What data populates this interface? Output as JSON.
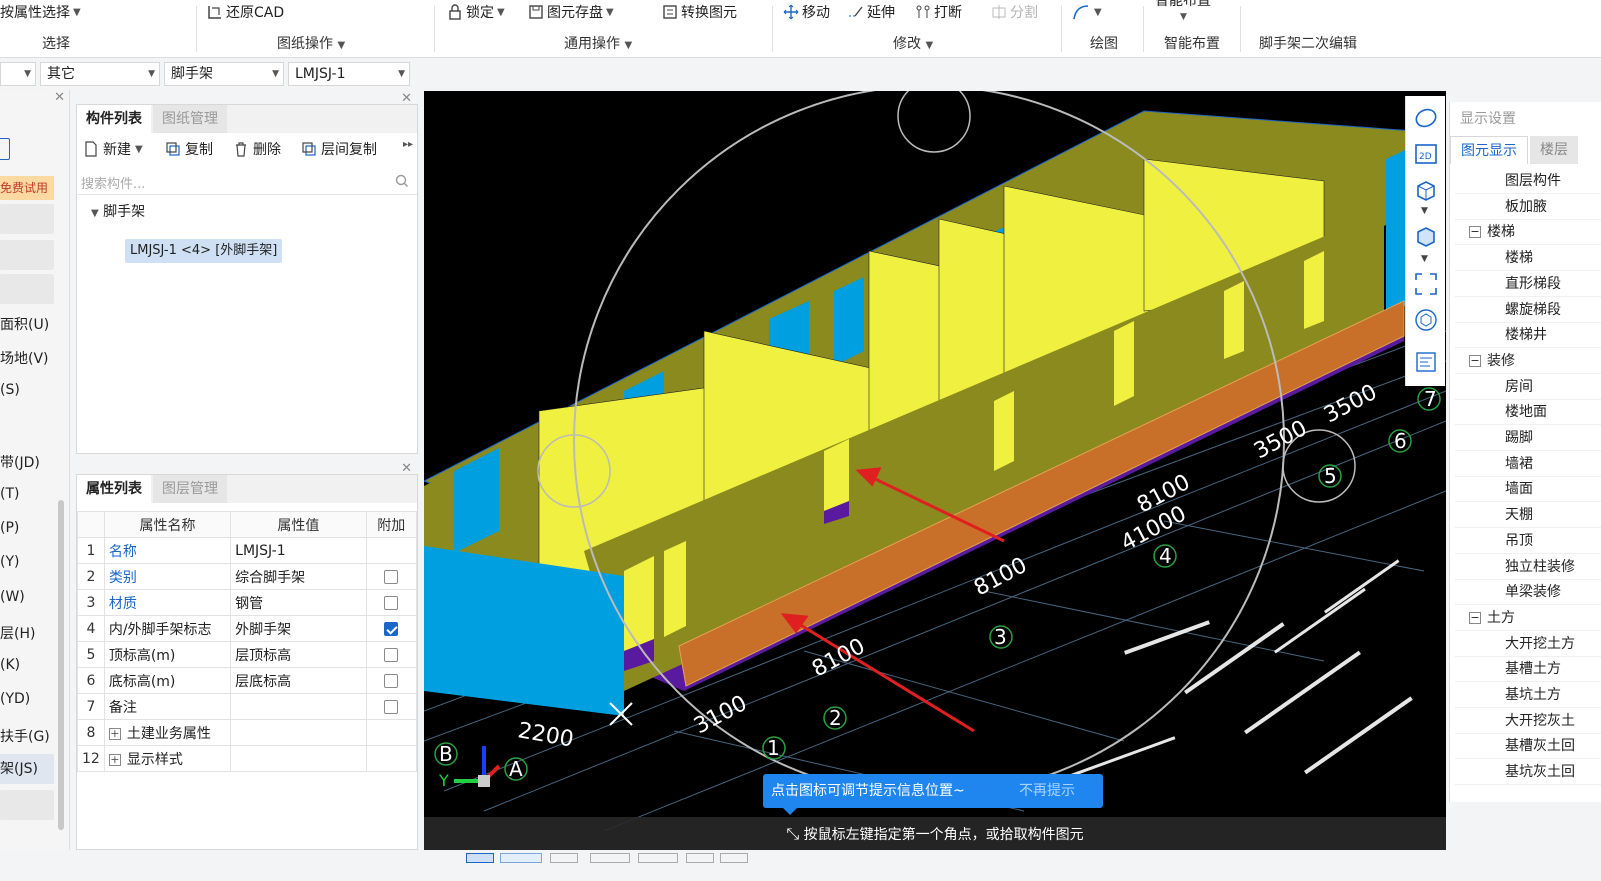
{
  "ribbon": {
    "select_prop": "按属性选择",
    "select_label": "选择",
    "restore_cad": "还原CAD",
    "drawing_ops_label": "图纸操作",
    "lock": "锁定",
    "element_save": "图元存盘",
    "convert_element": "转换图元",
    "common_ops_label": "通用操作",
    "move": "移动",
    "extend": "延伸",
    "break": "打断",
    "split": "分割",
    "modify_label": "修改",
    "draw_label": "绘图",
    "smart_layout": "智能布置",
    "smart_layout_label": "智能布置",
    "scaffold_edit_label": "脚手架二次编辑"
  },
  "combos": {
    "c1": "其它",
    "c2": "脚手架",
    "c3": "LMJSJ-1"
  },
  "left_strip": {
    "free_trial": "免费试用",
    "items": [
      "面积(U)",
      "场地(V)",
      "(S)",
      "带(JD)",
      "(T)",
      "(P)",
      "(Y)",
      "(W)",
      "层(H)",
      "(K)",
      "(YD)",
      "扶手(G)",
      "架(JS)"
    ]
  },
  "component_panel": {
    "tab_component_list": "构件列表",
    "tab_drawing_mgmt": "图纸管理",
    "new": "新建",
    "copy": "复制",
    "delete": "删除",
    "floor_copy": "层间复制",
    "search_placeholder": "搜索构件...",
    "tree_root": "脚手架",
    "tree_item": "LMJSJ-1 <4> [外脚手架]"
  },
  "property_panel": {
    "tab_props": "属性列表",
    "tab_layers": "图层管理",
    "col_name": "属性名称",
    "col_value": "属性值",
    "col_extra": "附加",
    "rows": [
      {
        "num": "1",
        "name": "名称",
        "value": "LMJSJ-1",
        "blue": true,
        "check": "none"
      },
      {
        "num": "2",
        "name": "类别",
        "value": "综合脚手架",
        "blue": true,
        "check": "off"
      },
      {
        "num": "3",
        "name": "材质",
        "value": "钢管",
        "blue": true,
        "check": "off"
      },
      {
        "num": "4",
        "name": "内/外脚手架标志",
        "value": "外脚手架",
        "blue": false,
        "check": "on"
      },
      {
        "num": "5",
        "name": "顶标高(m)",
        "value": "层顶标高",
        "blue": false,
        "check": "off"
      },
      {
        "num": "6",
        "name": "底标高(m)",
        "value": "层底标高",
        "blue": false,
        "check": "off"
      },
      {
        "num": "7",
        "name": "备注",
        "value": "",
        "blue": false,
        "check": "off"
      },
      {
        "num": "8",
        "name": "土建业务属性",
        "value": "",
        "blue": false,
        "check": "none",
        "expand": true
      },
      {
        "num": "12",
        "name": "显示样式",
        "value": "",
        "blue": false,
        "check": "none",
        "expand": true
      }
    ]
  },
  "viewport": {
    "dims": [
      "3500",
      "3500",
      "8100",
      "41000",
      "8100",
      "8100",
      "3100",
      "2200"
    ],
    "axis_nums": [
      "7",
      "6",
      "5",
      "4",
      "3",
      "2",
      "1"
    ],
    "axis_letters": [
      "B",
      "A"
    ],
    "axis_y": "Y",
    "status_text": "按鼠标左键指定第一个角点，或拾取构件图元"
  },
  "tip": {
    "text": "点击图标可调节提示信息位置~",
    "dismiss": "不再提示"
  },
  "display_panel": {
    "title": "显示设置",
    "tab_element": "图元显示",
    "tab_floor": "楼层",
    "rows": [
      {
        "label": "图层构件",
        "group": false
      },
      {
        "label": "板加腋",
        "group": false
      },
      {
        "label": "楼梯",
        "group": true
      },
      {
        "label": "楼梯",
        "group": false
      },
      {
        "label": "直形梯段",
        "group": false
      },
      {
        "label": "螺旋梯段",
        "group": false
      },
      {
        "label": "楼梯井",
        "group": false
      },
      {
        "label": "装修",
        "group": true
      },
      {
        "label": "房间",
        "group": false
      },
      {
        "label": "楼地面",
        "group": false
      },
      {
        "label": "踢脚",
        "group": false
      },
      {
        "label": "墙裙",
        "group": false
      },
      {
        "label": "墙面",
        "group": false
      },
      {
        "label": "天棚",
        "group": false
      },
      {
        "label": "吊顶",
        "group": false
      },
      {
        "label": "独立柱装修",
        "group": false
      },
      {
        "label": "单梁装修",
        "group": false
      },
      {
        "label": "土方",
        "group": true
      },
      {
        "label": "大开挖土方",
        "group": false
      },
      {
        "label": "基槽土方",
        "group": false
      },
      {
        "label": "基坑土方",
        "group": false
      },
      {
        "label": "大开挖灰土",
        "group": false
      },
      {
        "label": "基槽灰土回",
        "group": false
      },
      {
        "label": "基坑灰土回",
        "group": false
      }
    ]
  },
  "colors": {
    "accent": "#1a66c9",
    "wall_yellow": "#f0f040",
    "wall_olive": "#8a8a1e",
    "wall_cyan": "#00a0e0",
    "scaffold_orange": "#c8702a",
    "floor_purple": "#5a1aa0",
    "arrow_red": "#e02020"
  }
}
